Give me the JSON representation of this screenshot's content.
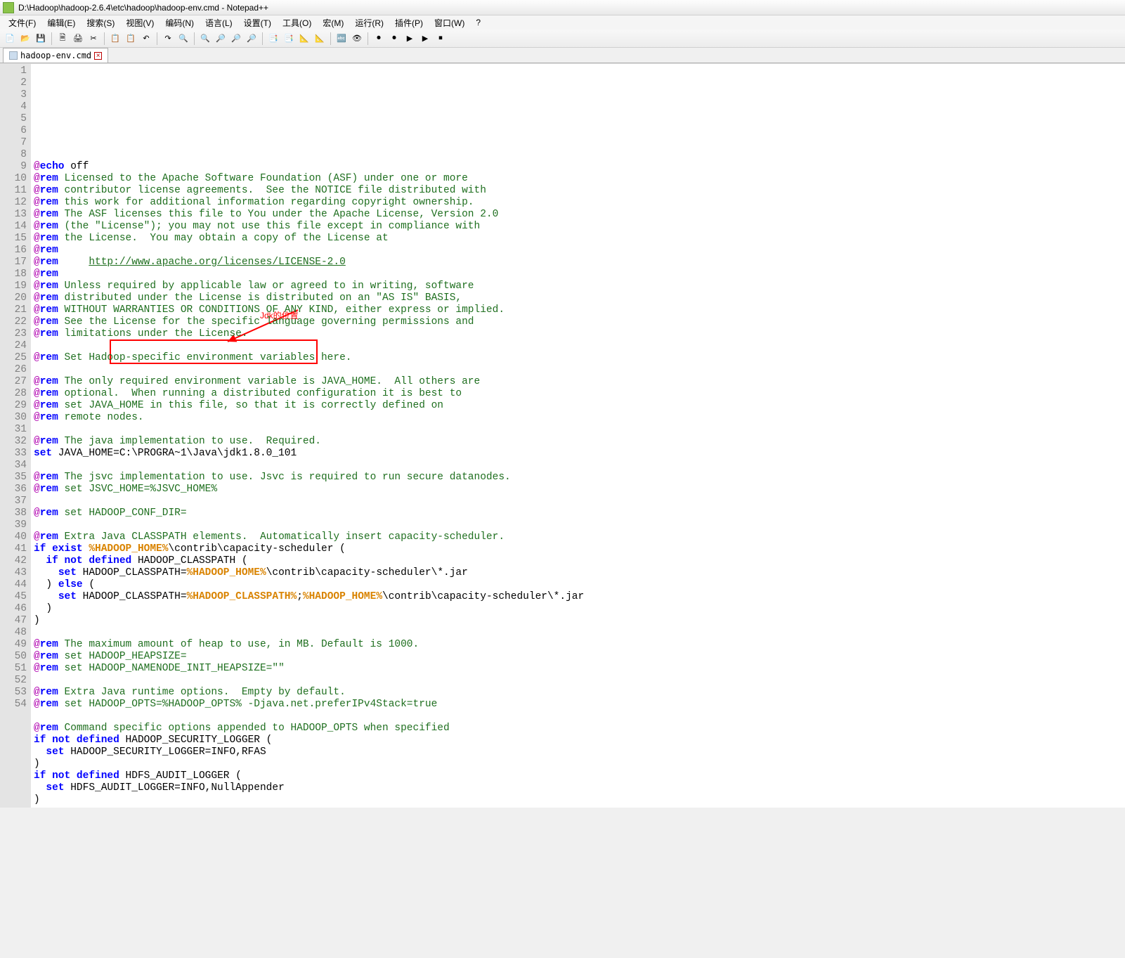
{
  "title": "D:\\Hadoop\\hadoop-2.6.4\\etc\\hadoop\\hadoop-env.cmd - Notepad++",
  "menus": [
    "文件(F)",
    "编辑(E)",
    "搜索(S)",
    "视图(V)",
    "编码(N)",
    "语言(L)",
    "设置(T)",
    "工具(O)",
    "宏(M)",
    "运行(R)",
    "插件(P)",
    "窗口(W)",
    "?"
  ],
  "tab": {
    "label": "hadoop-env.cmd",
    "close": "×"
  },
  "toolbar_icons": [
    "📄",
    "📂",
    "💾",
    "🗎",
    "🖨",
    "✂",
    "📋",
    "📋",
    "↶",
    "↷",
    "🔍",
    "🔍",
    "🔎",
    "🔎",
    "🔎",
    "📑",
    "📑",
    "📐",
    "📐",
    "🔤",
    "👁",
    "⏺",
    "⏺",
    "▶",
    "▶",
    "⏹"
  ],
  "annotation": {
    "label": "Jdk的位置"
  },
  "lines": [
    {
      "n": 1,
      "seg": [
        [
          "at",
          "@"
        ],
        [
          "kw",
          "echo"
        ],
        [
          "str",
          " off"
        ]
      ]
    },
    {
      "n": 2,
      "seg": [
        [
          "at",
          "@"
        ],
        [
          "kw",
          "rem"
        ],
        [
          "rem",
          " Licensed to the Apache Software Foundation (ASF) under one or more"
        ]
      ]
    },
    {
      "n": 3,
      "seg": [
        [
          "at",
          "@"
        ],
        [
          "kw",
          "rem"
        ],
        [
          "rem",
          " contributor license agreements.  See the NOTICE file distributed with"
        ]
      ]
    },
    {
      "n": 4,
      "seg": [
        [
          "at",
          "@"
        ],
        [
          "kw",
          "rem"
        ],
        [
          "rem",
          " this work for additional information regarding copyright ownership."
        ]
      ]
    },
    {
      "n": 5,
      "seg": [
        [
          "at",
          "@"
        ],
        [
          "kw",
          "rem"
        ],
        [
          "rem",
          " The ASF licenses this file to You under the Apache License, Version 2.0"
        ]
      ]
    },
    {
      "n": 6,
      "seg": [
        [
          "at",
          "@"
        ],
        [
          "kw",
          "rem"
        ],
        [
          "rem",
          " (the \"License\"); you may not use this file except in compliance with"
        ]
      ]
    },
    {
      "n": 7,
      "seg": [
        [
          "at",
          "@"
        ],
        [
          "kw",
          "rem"
        ],
        [
          "rem",
          " the License.  You may obtain a copy of the License at"
        ]
      ]
    },
    {
      "n": 8,
      "seg": [
        [
          "at",
          "@"
        ],
        [
          "kw",
          "rem"
        ]
      ]
    },
    {
      "n": 9,
      "seg": [
        [
          "at",
          "@"
        ],
        [
          "kw",
          "rem"
        ],
        [
          "rem",
          "     "
        ],
        [
          "link",
          "http://www.apache.org/licenses/LICENSE-2.0"
        ]
      ]
    },
    {
      "n": 10,
      "seg": [
        [
          "at",
          "@"
        ],
        [
          "kw",
          "rem"
        ]
      ]
    },
    {
      "n": 11,
      "seg": [
        [
          "at",
          "@"
        ],
        [
          "kw",
          "rem"
        ],
        [
          "rem",
          " Unless required by applicable law or agreed to in writing, software"
        ]
      ]
    },
    {
      "n": 12,
      "seg": [
        [
          "at",
          "@"
        ],
        [
          "kw",
          "rem"
        ],
        [
          "rem",
          " distributed under the License is distributed on an \"AS IS\" BASIS,"
        ]
      ]
    },
    {
      "n": 13,
      "seg": [
        [
          "at",
          "@"
        ],
        [
          "kw",
          "rem"
        ],
        [
          "rem",
          " WITHOUT WARRANTIES OR CONDITIONS OF ANY KIND, either express or implied."
        ]
      ]
    },
    {
      "n": 14,
      "seg": [
        [
          "at",
          "@"
        ],
        [
          "kw",
          "rem"
        ],
        [
          "rem",
          " See the License for the specific language governing permissions and"
        ]
      ]
    },
    {
      "n": 15,
      "seg": [
        [
          "at",
          "@"
        ],
        [
          "kw",
          "rem"
        ],
        [
          "rem",
          " limitations under the License."
        ]
      ]
    },
    {
      "n": 16,
      "seg": []
    },
    {
      "n": 17,
      "seg": [
        [
          "at",
          "@"
        ],
        [
          "kw",
          "rem"
        ],
        [
          "rem",
          " Set Hadoop-specific environment variables here."
        ]
      ]
    },
    {
      "n": 18,
      "seg": []
    },
    {
      "n": 19,
      "seg": [
        [
          "at",
          "@"
        ],
        [
          "kw",
          "rem"
        ],
        [
          "rem",
          " The only required environment variable is JAVA_HOME.  All others are"
        ]
      ]
    },
    {
      "n": 20,
      "seg": [
        [
          "at",
          "@"
        ],
        [
          "kw",
          "rem"
        ],
        [
          "rem",
          " optional.  When running a distributed configuration it is best to"
        ]
      ]
    },
    {
      "n": 21,
      "seg": [
        [
          "at",
          "@"
        ],
        [
          "kw",
          "rem"
        ],
        [
          "rem",
          " set JAVA_HOME in this file, so that it is correctly defined on"
        ]
      ]
    },
    {
      "n": 22,
      "hl": true,
      "seg": [
        [
          "at",
          "@"
        ],
        [
          "kw",
          "rem"
        ],
        [
          "rem",
          " remote nodes."
        ]
      ]
    },
    {
      "n": 23,
      "seg": []
    },
    {
      "n": 24,
      "seg": [
        [
          "at",
          "@"
        ],
        [
          "kw",
          "rem"
        ],
        [
          "rem",
          " The java implementation to use.  Required."
        ]
      ]
    },
    {
      "n": 25,
      "seg": [
        [
          "kw",
          "set"
        ],
        [
          "str",
          " JAVA_HOME=C:\\PROGRA~1\\Java\\jdk1.8.0_101"
        ]
      ]
    },
    {
      "n": 26,
      "seg": []
    },
    {
      "n": 27,
      "seg": [
        [
          "at",
          "@"
        ],
        [
          "kw",
          "rem"
        ],
        [
          "rem",
          " The jsvc implementation to use. Jsvc is required to run secure datanodes."
        ]
      ]
    },
    {
      "n": 28,
      "seg": [
        [
          "at",
          "@"
        ],
        [
          "kw",
          "rem"
        ],
        [
          "rem",
          " set JSVC_HOME=%JSVC_HOME%"
        ]
      ]
    },
    {
      "n": 29,
      "seg": []
    },
    {
      "n": 30,
      "seg": [
        [
          "at",
          "@"
        ],
        [
          "kw",
          "rem"
        ],
        [
          "rem",
          " set HADOOP_CONF_DIR="
        ]
      ]
    },
    {
      "n": 31,
      "seg": []
    },
    {
      "n": 32,
      "seg": [
        [
          "at",
          "@"
        ],
        [
          "kw",
          "rem"
        ],
        [
          "rem",
          " Extra Java CLASSPATH elements.  Automatically insert capacity-scheduler."
        ]
      ]
    },
    {
      "n": 33,
      "seg": [
        [
          "kw",
          "if"
        ],
        [
          "str",
          " "
        ],
        [
          "kw",
          "exist"
        ],
        [
          "str",
          " "
        ],
        [
          "env",
          "%HADOOP_HOME%"
        ],
        [
          "str",
          "\\contrib\\capacity-scheduler ("
        ]
      ]
    },
    {
      "n": 34,
      "seg": [
        [
          "str",
          "  "
        ],
        [
          "kw",
          "if"
        ],
        [
          "str",
          " "
        ],
        [
          "kw",
          "not"
        ],
        [
          "str",
          " "
        ],
        [
          "kw",
          "defined"
        ],
        [
          "str",
          " HADOOP_CLASSPATH ("
        ]
      ]
    },
    {
      "n": 35,
      "seg": [
        [
          "str",
          "    "
        ],
        [
          "kw",
          "set"
        ],
        [
          "str",
          " HADOOP_CLASSPATH="
        ],
        [
          "env",
          "%HADOOP_HOME%"
        ],
        [
          "str",
          "\\contrib\\capacity-scheduler\\*.jar"
        ]
      ]
    },
    {
      "n": 36,
      "seg": [
        [
          "str",
          "  ) "
        ],
        [
          "kw",
          "else"
        ],
        [
          "str",
          " ("
        ]
      ]
    },
    {
      "n": 37,
      "seg": [
        [
          "str",
          "    "
        ],
        [
          "kw",
          "set"
        ],
        [
          "str",
          " HADOOP_CLASSPATH="
        ],
        [
          "env",
          "%HADOOP_CLASSPATH%"
        ],
        [
          "str",
          ";"
        ],
        [
          "env",
          "%HADOOP_HOME%"
        ],
        [
          "str",
          "\\contrib\\capacity-scheduler\\*.jar"
        ]
      ]
    },
    {
      "n": 38,
      "seg": [
        [
          "str",
          "  )"
        ]
      ]
    },
    {
      "n": 39,
      "seg": [
        [
          "str",
          ")"
        ]
      ]
    },
    {
      "n": 40,
      "seg": []
    },
    {
      "n": 41,
      "seg": [
        [
          "at",
          "@"
        ],
        [
          "kw",
          "rem"
        ],
        [
          "rem",
          " The maximum amount of heap to use, in MB. Default is 1000."
        ]
      ]
    },
    {
      "n": 42,
      "seg": [
        [
          "at",
          "@"
        ],
        [
          "kw",
          "rem"
        ],
        [
          "rem",
          " set HADOOP_HEAPSIZE="
        ]
      ]
    },
    {
      "n": 43,
      "seg": [
        [
          "at",
          "@"
        ],
        [
          "kw",
          "rem"
        ],
        [
          "rem",
          " set HADOOP_NAMENODE_INIT_HEAPSIZE=\"\""
        ]
      ]
    },
    {
      "n": 44,
      "seg": []
    },
    {
      "n": 45,
      "seg": [
        [
          "at",
          "@"
        ],
        [
          "kw",
          "rem"
        ],
        [
          "rem",
          " Extra Java runtime options.  Empty by default."
        ]
      ]
    },
    {
      "n": 46,
      "seg": [
        [
          "at",
          "@"
        ],
        [
          "kw",
          "rem"
        ],
        [
          "rem",
          " set HADOOP_OPTS=%HADOOP_OPTS% -Djava.net.preferIPv4Stack=true"
        ]
      ]
    },
    {
      "n": 47,
      "seg": []
    },
    {
      "n": 48,
      "seg": [
        [
          "at",
          "@"
        ],
        [
          "kw",
          "rem"
        ],
        [
          "rem",
          " Command specific options appended to HADOOP_OPTS when specified"
        ]
      ]
    },
    {
      "n": 49,
      "seg": [
        [
          "kw",
          "if"
        ],
        [
          "str",
          " "
        ],
        [
          "kw",
          "not"
        ],
        [
          "str",
          " "
        ],
        [
          "kw",
          "defined"
        ],
        [
          "str",
          " HADOOP_SECURITY_LOGGER ("
        ]
      ]
    },
    {
      "n": 50,
      "seg": [
        [
          "str",
          "  "
        ],
        [
          "kw",
          "set"
        ],
        [
          "str",
          " HADOOP_SECURITY_LOGGER=INFO,RFAS"
        ]
      ]
    },
    {
      "n": 51,
      "seg": [
        [
          "str",
          ")"
        ]
      ]
    },
    {
      "n": 52,
      "seg": [
        [
          "kw",
          "if"
        ],
        [
          "str",
          " "
        ],
        [
          "kw",
          "not"
        ],
        [
          "str",
          " "
        ],
        [
          "kw",
          "defined"
        ],
        [
          "str",
          " HDFS_AUDIT_LOGGER ("
        ]
      ]
    },
    {
      "n": 53,
      "seg": [
        [
          "str",
          "  "
        ],
        [
          "kw",
          "set"
        ],
        [
          "str",
          " HDFS_AUDIT_LOGGER=INFO,NullAppender"
        ]
      ]
    },
    {
      "n": 54,
      "seg": [
        [
          "str",
          ")"
        ]
      ]
    }
  ]
}
